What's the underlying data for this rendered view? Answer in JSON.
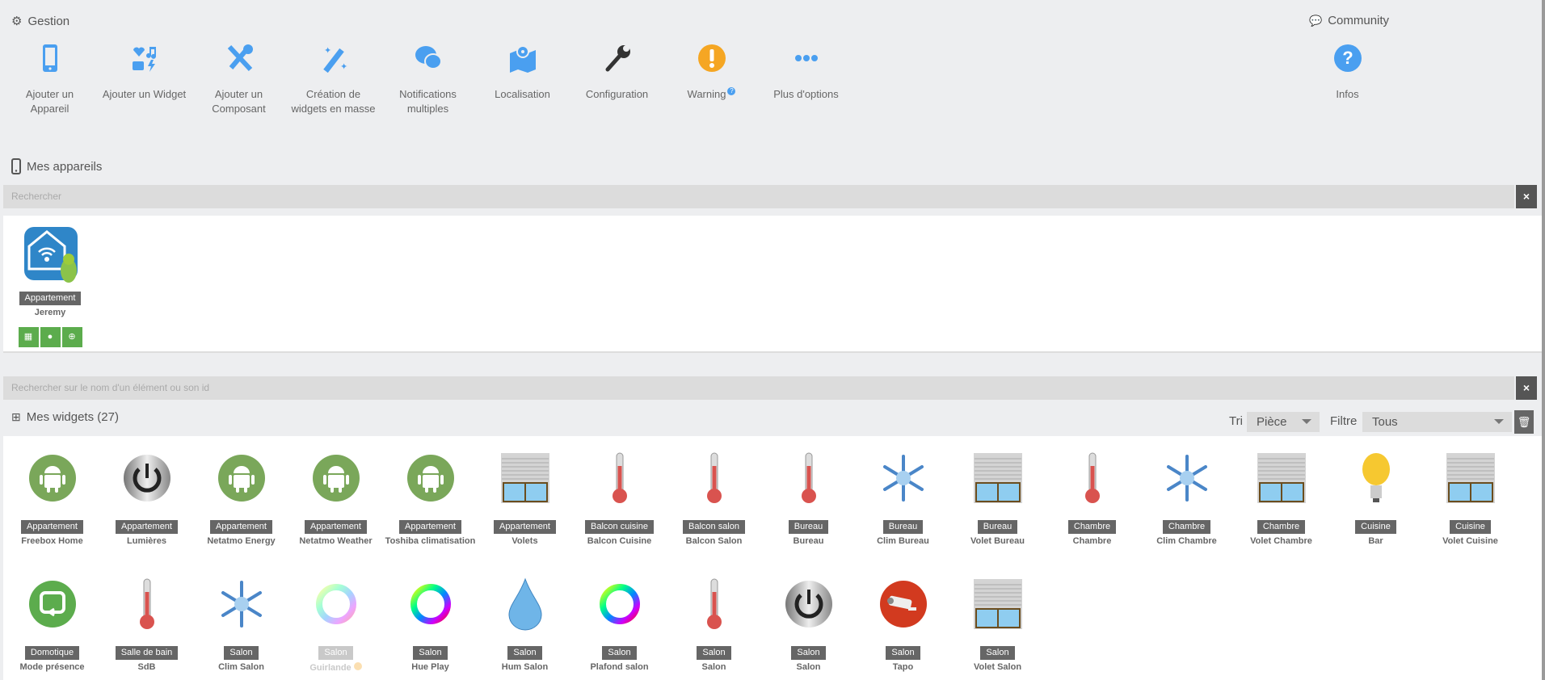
{
  "gestion": {
    "title": "Gestion",
    "items": [
      {
        "label": "Ajouter un Appareil",
        "icon": "mobile-icon"
      },
      {
        "label": "Ajouter un Widget",
        "icon": "widgets-icon"
      },
      {
        "label": "Ajouter un Composant",
        "icon": "tools-icon"
      },
      {
        "label": "Création de widgets en masse",
        "icon": "magic-wand-icon"
      },
      {
        "label": "Notifications multiples",
        "icon": "comments-icon"
      },
      {
        "label": "Localisation",
        "icon": "map-icon"
      },
      {
        "label": "Configuration",
        "icon": "wrench-icon"
      },
      {
        "label": "Warning",
        "icon": "warning-icon",
        "help": "?"
      },
      {
        "label": "Plus d'options",
        "icon": "more-icon"
      }
    ]
  },
  "community": {
    "title": "Community",
    "items": [
      {
        "label": "Infos",
        "icon": "question-icon"
      }
    ]
  },
  "devices": {
    "title": "Mes appareils",
    "search_placeholder": "Rechercher",
    "close": "×",
    "items": [
      {
        "room": "Appartement",
        "name": "Jeremy"
      }
    ]
  },
  "widgets": {
    "title": "Mes widgets (27)",
    "search_placeholder": "Rechercher sur le nom d'un élément ou son id",
    "close": "×",
    "sort_label": "Tri",
    "sort_value": "Pièce",
    "filter_label": "Filtre",
    "filter_value": "Tous",
    "items": [
      {
        "room": "Appartement",
        "name": "Freebox Home",
        "icon": "android"
      },
      {
        "room": "Appartement",
        "name": "Lumières",
        "icon": "power"
      },
      {
        "room": "Appartement",
        "name": "Netatmo Energy",
        "icon": "android"
      },
      {
        "room": "Appartement",
        "name": "Netatmo Weather",
        "icon": "android"
      },
      {
        "room": "Appartement",
        "name": "Toshiba climatisation",
        "icon": "android"
      },
      {
        "room": "Appartement",
        "name": "Volets",
        "icon": "shutter"
      },
      {
        "room": "Balcon cuisine",
        "name": "Balcon Cuisine",
        "icon": "thermo"
      },
      {
        "room": "Balcon salon",
        "name": "Balcon Salon",
        "icon": "thermo"
      },
      {
        "room": "Bureau",
        "name": "Bureau",
        "icon": "thermo"
      },
      {
        "room": "Bureau",
        "name": "Clim Bureau",
        "icon": "snow"
      },
      {
        "room": "Bureau",
        "name": "Volet Bureau",
        "icon": "shutter"
      },
      {
        "room": "Chambre",
        "name": "Chambre",
        "icon": "thermo"
      },
      {
        "room": "Chambre",
        "name": "Clim Chambre",
        "icon": "snow"
      },
      {
        "room": "Chambre",
        "name": "Volet Chambre",
        "icon": "shutter"
      },
      {
        "room": "Cuisine",
        "name": "Bar",
        "icon": "bulb"
      },
      {
        "room": "Cuisine",
        "name": "Volet Cuisine",
        "icon": "shutter"
      },
      {
        "room": "Domotique",
        "name": "Mode présence",
        "icon": "presence"
      },
      {
        "room": "Salle de bain",
        "name": "SdB",
        "icon": "thermo"
      },
      {
        "room": "Salon",
        "name": "Clim Salon",
        "icon": "snow"
      },
      {
        "room": "Salon",
        "name": "Guirlande",
        "icon": "ring",
        "disabled": true
      },
      {
        "room": "Salon",
        "name": "Hue Play",
        "icon": "ring"
      },
      {
        "room": "Salon",
        "name": "Hum Salon",
        "icon": "drop"
      },
      {
        "room": "Salon",
        "name": "Plafond salon",
        "icon": "ring"
      },
      {
        "room": "Salon",
        "name": "Salon",
        "icon": "thermo"
      },
      {
        "room": "Salon",
        "name": "Salon",
        "icon": "power"
      },
      {
        "room": "Salon",
        "name": "Tapo",
        "icon": "camera"
      },
      {
        "room": "Salon",
        "name": "Volet Salon",
        "icon": "shutter"
      }
    ]
  },
  "colors": {
    "accent": "#4a9ff0",
    "warning": "#f5a623",
    "green": "#5cac4d",
    "badge": "#666666"
  }
}
